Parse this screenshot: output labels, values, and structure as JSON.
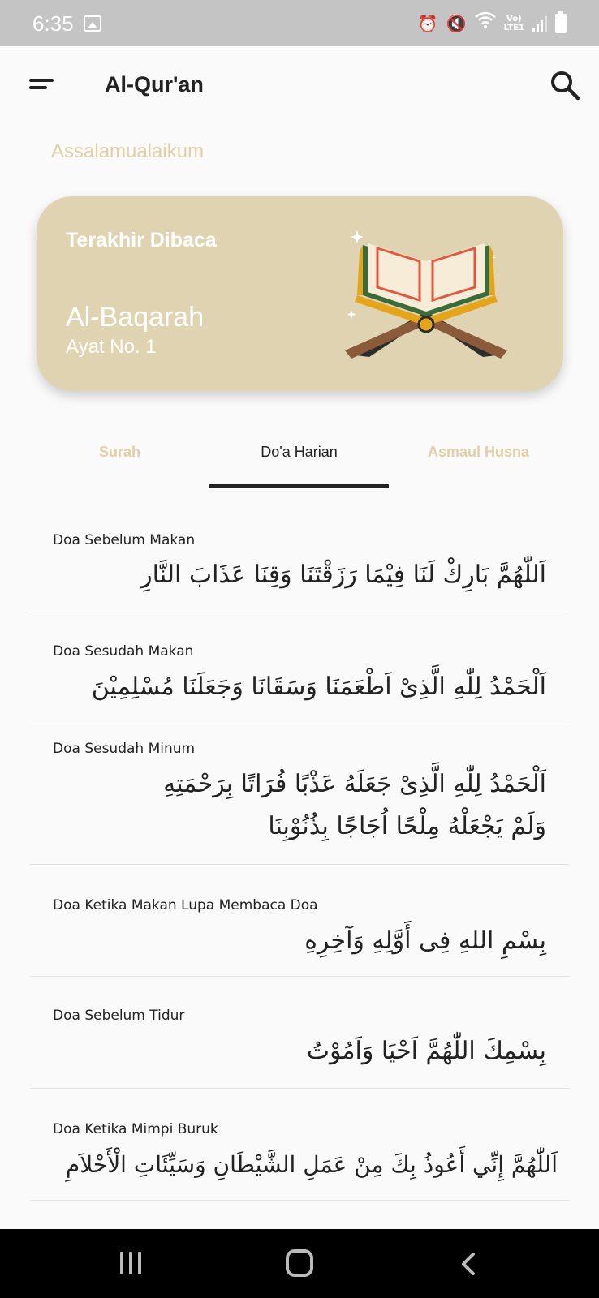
{
  "status_bar": {
    "time": "6:35",
    "lte_top": "Vo)",
    "lte_bottom": "LTE1"
  },
  "app_bar": {
    "title": "Al-Qur'an",
    "menu_icon": "menu-icon",
    "search_icon": "search-icon"
  },
  "greeting": "Assalamualaikum",
  "last_read": {
    "label": "Terakhir Dibaca",
    "surah": "Al-Baqarah",
    "ayat": "Ayat No. 1",
    "illustration": "quran-book-illustration"
  },
  "tabs": [
    {
      "label": "Surah",
      "active": false
    },
    {
      "label": "Do'a Harian",
      "active": true
    },
    {
      "label": "Asmaul Husna",
      "active": false
    }
  ],
  "doa_items": [
    {
      "title": "Doa Sebelum Makan",
      "arabic": "اَللّٰهُمَّ بَارِكْ لَنَا فِيْمَا رَزَقْتَنَا وَقِنَا عَذَابَ النَّارِ"
    },
    {
      "title": "Doa Sesudah Makan",
      "arabic": "اَلْحَمْدُ لِلّٰهِ الَّذِىْ اَطْعَمَنَا وَسَقَانَا وَجَعَلَنَا مُسْلِمِيْنَ"
    },
    {
      "title": "Doa Sesudah  Minum",
      "arabic": "اَلْحَمْدُ لِلّٰهِ الَّذِىْ جَعَلَهُ عَذْبًا فُرَاتًا بِرَحْمَتِهِ وَلَمْ يَجْعَلْهُ مِلْحًا اُجَاجًا بِذُنُوْبِنَا"
    },
    {
      "title": "Doa Ketika Makan Lupa Membaca Doa",
      "arabic": "بِسْمِ اللهِ فِى أَوَّلِهِ وَآخِرِهِ"
    },
    {
      "title": "Doa Sebelum Tidur",
      "arabic": "بِسْمِكَ اللّٰهُمَّ اَحْيَا وَاَمُوْتُ"
    },
    {
      "title": "Doa Ketika Mimpi Buruk",
      "arabic": "اَللّٰهُمَّ إِنِّي أَعُوذُ بِكَ مِنْ عَمَلِ الشَّيْطَانِ وَسَيِّئَاتِ الْأَحْلاَمِ"
    }
  ],
  "nav_bar": {
    "recent_icon": "recent-apps-icon",
    "home_icon": "home-icon",
    "back_icon": "back-icon"
  },
  "colors": {
    "accent": "#e2cfa6",
    "card": "#e0d3b1",
    "text": "#222222"
  }
}
